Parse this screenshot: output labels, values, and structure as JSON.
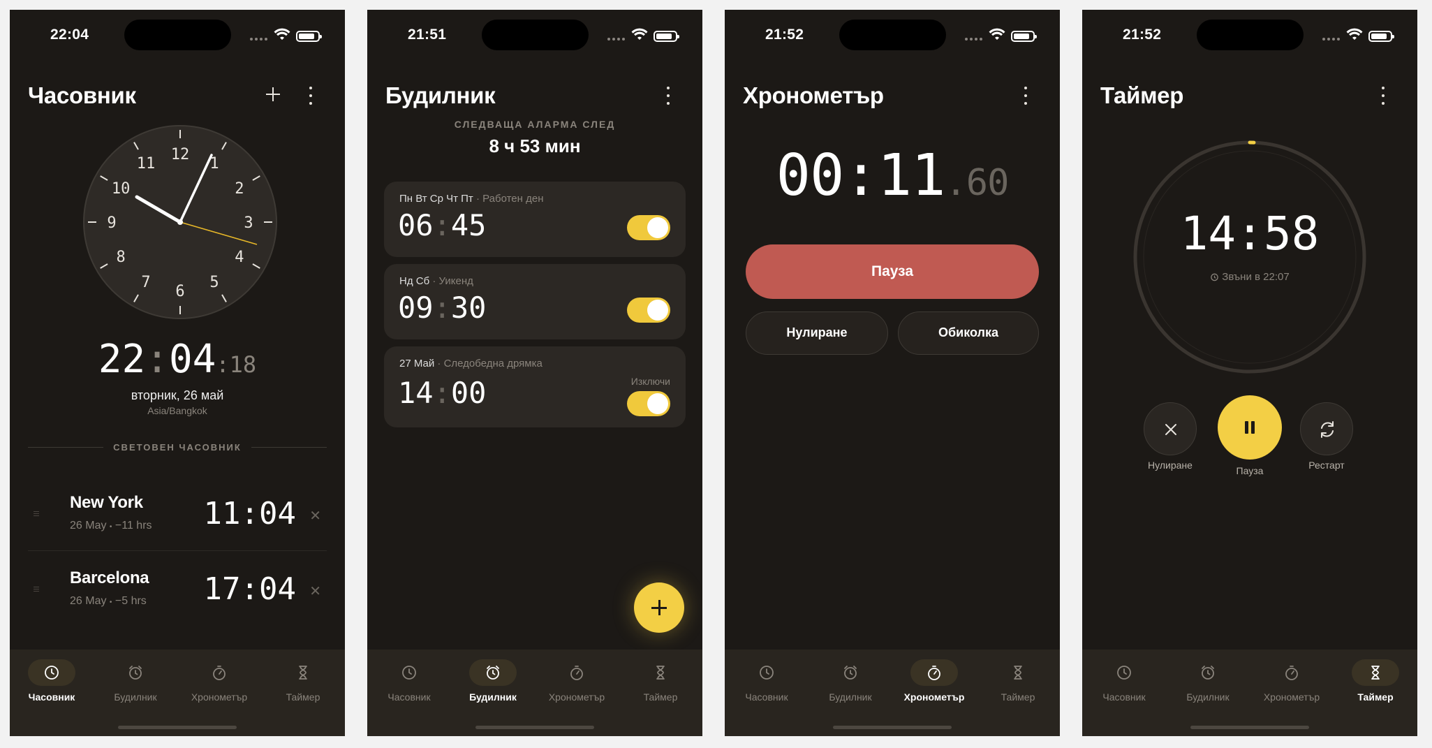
{
  "status_bars": [
    {
      "time": "22:04"
    },
    {
      "time": "21:51"
    },
    {
      "time": "21:52"
    },
    {
      "time": "21:52"
    }
  ],
  "tabs": [
    {
      "label": "Часовник",
      "icon": "clock-icon"
    },
    {
      "label": "Будилник",
      "icon": "alarm-icon"
    },
    {
      "label": "Хронометър",
      "icon": "stopwatch-icon"
    },
    {
      "label": "Таймер",
      "icon": "hourglass-icon"
    }
  ],
  "clock_screen": {
    "title": "Часовник",
    "analog_numbers": [
      "12",
      "1",
      "2",
      "3",
      "4",
      "5",
      "6",
      "7",
      "8",
      "9",
      "10",
      "11"
    ],
    "time_h": "22",
    "time_m": "04",
    "time_s": "18",
    "separator": ":",
    "date": "вторник, 26 май",
    "timezone": "Asia/Bangkok",
    "world_header": "СВЕТОВЕН ЧАСОВНИК",
    "cities": [
      {
        "name": "New York",
        "date": "26 May",
        "offset": "−11 hrs",
        "time": "11:04"
      },
      {
        "name": "Barcelona",
        "date": "26 May",
        "offset": "−5 hrs",
        "time": "17:04"
      }
    ],
    "dot": "•",
    "remove": "✕"
  },
  "alarm_screen": {
    "title": "Будилник",
    "next_label": "СЛЕДВАЩА АЛАРМА СЛЕД",
    "next_value": "8 ч 53 мин",
    "alarms": [
      {
        "days": "Пн Вт Ср Чт Пт",
        "label": "· Работен ден",
        "hh": "06",
        "mm": "45",
        "enabled": true,
        "note": ""
      },
      {
        "days": "Нд Сб",
        "label": "· Уикенд",
        "hh": "09",
        "mm": "30",
        "enabled": true,
        "note": ""
      },
      {
        "days": "27 Май",
        "label": "· Следобедна дрямка",
        "hh": "14",
        "mm": "00",
        "enabled": true,
        "note": "Изключи"
      }
    ]
  },
  "stopwatch_screen": {
    "title": "Хронометър",
    "main": "00:11",
    "centis": ".60",
    "pause": "Пауза",
    "reset": "Нулиране",
    "lap": "Обиколка"
  },
  "timer_screen": {
    "title": "Таймер",
    "remaining": "14:58",
    "rings_at": "Звъни в 22:07",
    "progress_remaining_fraction": 0.998,
    "reset": "Нулиране",
    "pause": "Пауза",
    "restart": "Рестарт"
  },
  "colors": {
    "background": "#1c1916",
    "accent": "#f3cf45",
    "pause_red": "#c05a52",
    "tabbar": "#29251f"
  }
}
